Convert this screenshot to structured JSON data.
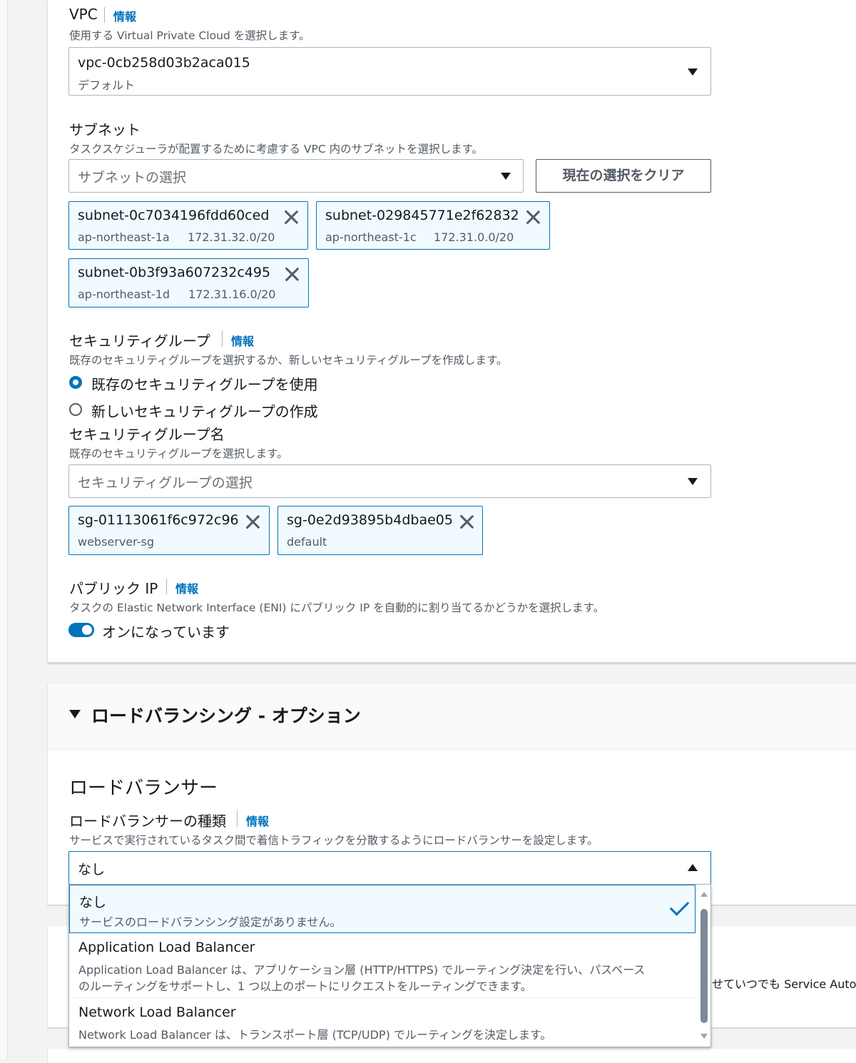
{
  "vpc": {
    "label": "VPC",
    "info": "情報",
    "description": "使用する Virtual Private Cloud を選択します。",
    "selected_id": "vpc-0cb258d03b2aca015",
    "selected_sub": "デフォルト"
  },
  "subnet": {
    "label": "サブネット",
    "description": "タスクスケジューラが配置するために考慮する VPC 内のサブネットを選択します。",
    "placeholder": "サブネットの選択",
    "clear_button": "現在の選択をクリア",
    "tokens": [
      {
        "id": "subnet-0c7034196fdd60ced",
        "az": "ap-northeast-1a",
        "cidr": "172.31.32.0/20"
      },
      {
        "id": "subnet-029845771e2f62832",
        "az": "ap-northeast-1c",
        "cidr": "172.31.0.0/20"
      },
      {
        "id": "subnet-0b3f93a607232c495",
        "az": "ap-northeast-1d",
        "cidr": "172.31.16.0/20"
      }
    ]
  },
  "security_group": {
    "label": "セキュリティグループ",
    "info": "情報",
    "description": "既存のセキュリティグループを選択するか、新しいセキュリティグループを作成します。",
    "radio_existing": "既存のセキュリティグループを使用",
    "radio_new": "新しいセキュリティグループの作成",
    "name_label": "セキュリティグループ名",
    "name_description": "既存のセキュリティグループを選択します。",
    "placeholder": "セキュリティグループの選択",
    "tokens": [
      {
        "id": "sg-01113061f6c972c96",
        "name": "webserver-sg"
      },
      {
        "id": "sg-0e2d93895b4dbae05",
        "name": "default"
      }
    ]
  },
  "public_ip": {
    "label": "パブリック IP",
    "info": "情報",
    "description": "タスクの Elastic Network Interface (ENI) にパブリック IP を自動的に割り当てるかどうかを選択します。",
    "toggle_label": "オンになっています",
    "enabled": true
  },
  "load_balancing": {
    "section_title": "ロードバランシング - オプション",
    "heading": "ロードバランサー",
    "type_label": "ロードバランサーの種類",
    "info": "情報",
    "description": "サービスで実行されているタスク間で着信トラフィックを分散するようにロードバランサーを設定します。",
    "selected": "なし",
    "options": [
      {
        "title": "なし",
        "desc": "サービスのロードバランシング設定がありません。",
        "desc2": ""
      },
      {
        "title": "Application Load Balancer",
        "desc": "Application Load Balancer は、アプリケーション層 (HTTP/HTTPS) でルーティング決定を行い、パスベース",
        "desc2": "のルーティングをサポートし、1 つ以上のポートにリクエストをルーティングできます。"
      },
      {
        "title": "Network Load Balancer",
        "desc": "Network Load Balancer は、トランスポート層 (TCP/UDP) でルーティングを決定します。",
        "desc2": ""
      }
    ]
  },
  "partial_text": "せていつでも Service Auto",
  "colors": {
    "accent": "#0073bb",
    "token_bg": "#f1faff",
    "text": "#16191f",
    "muted": "#545b64"
  }
}
